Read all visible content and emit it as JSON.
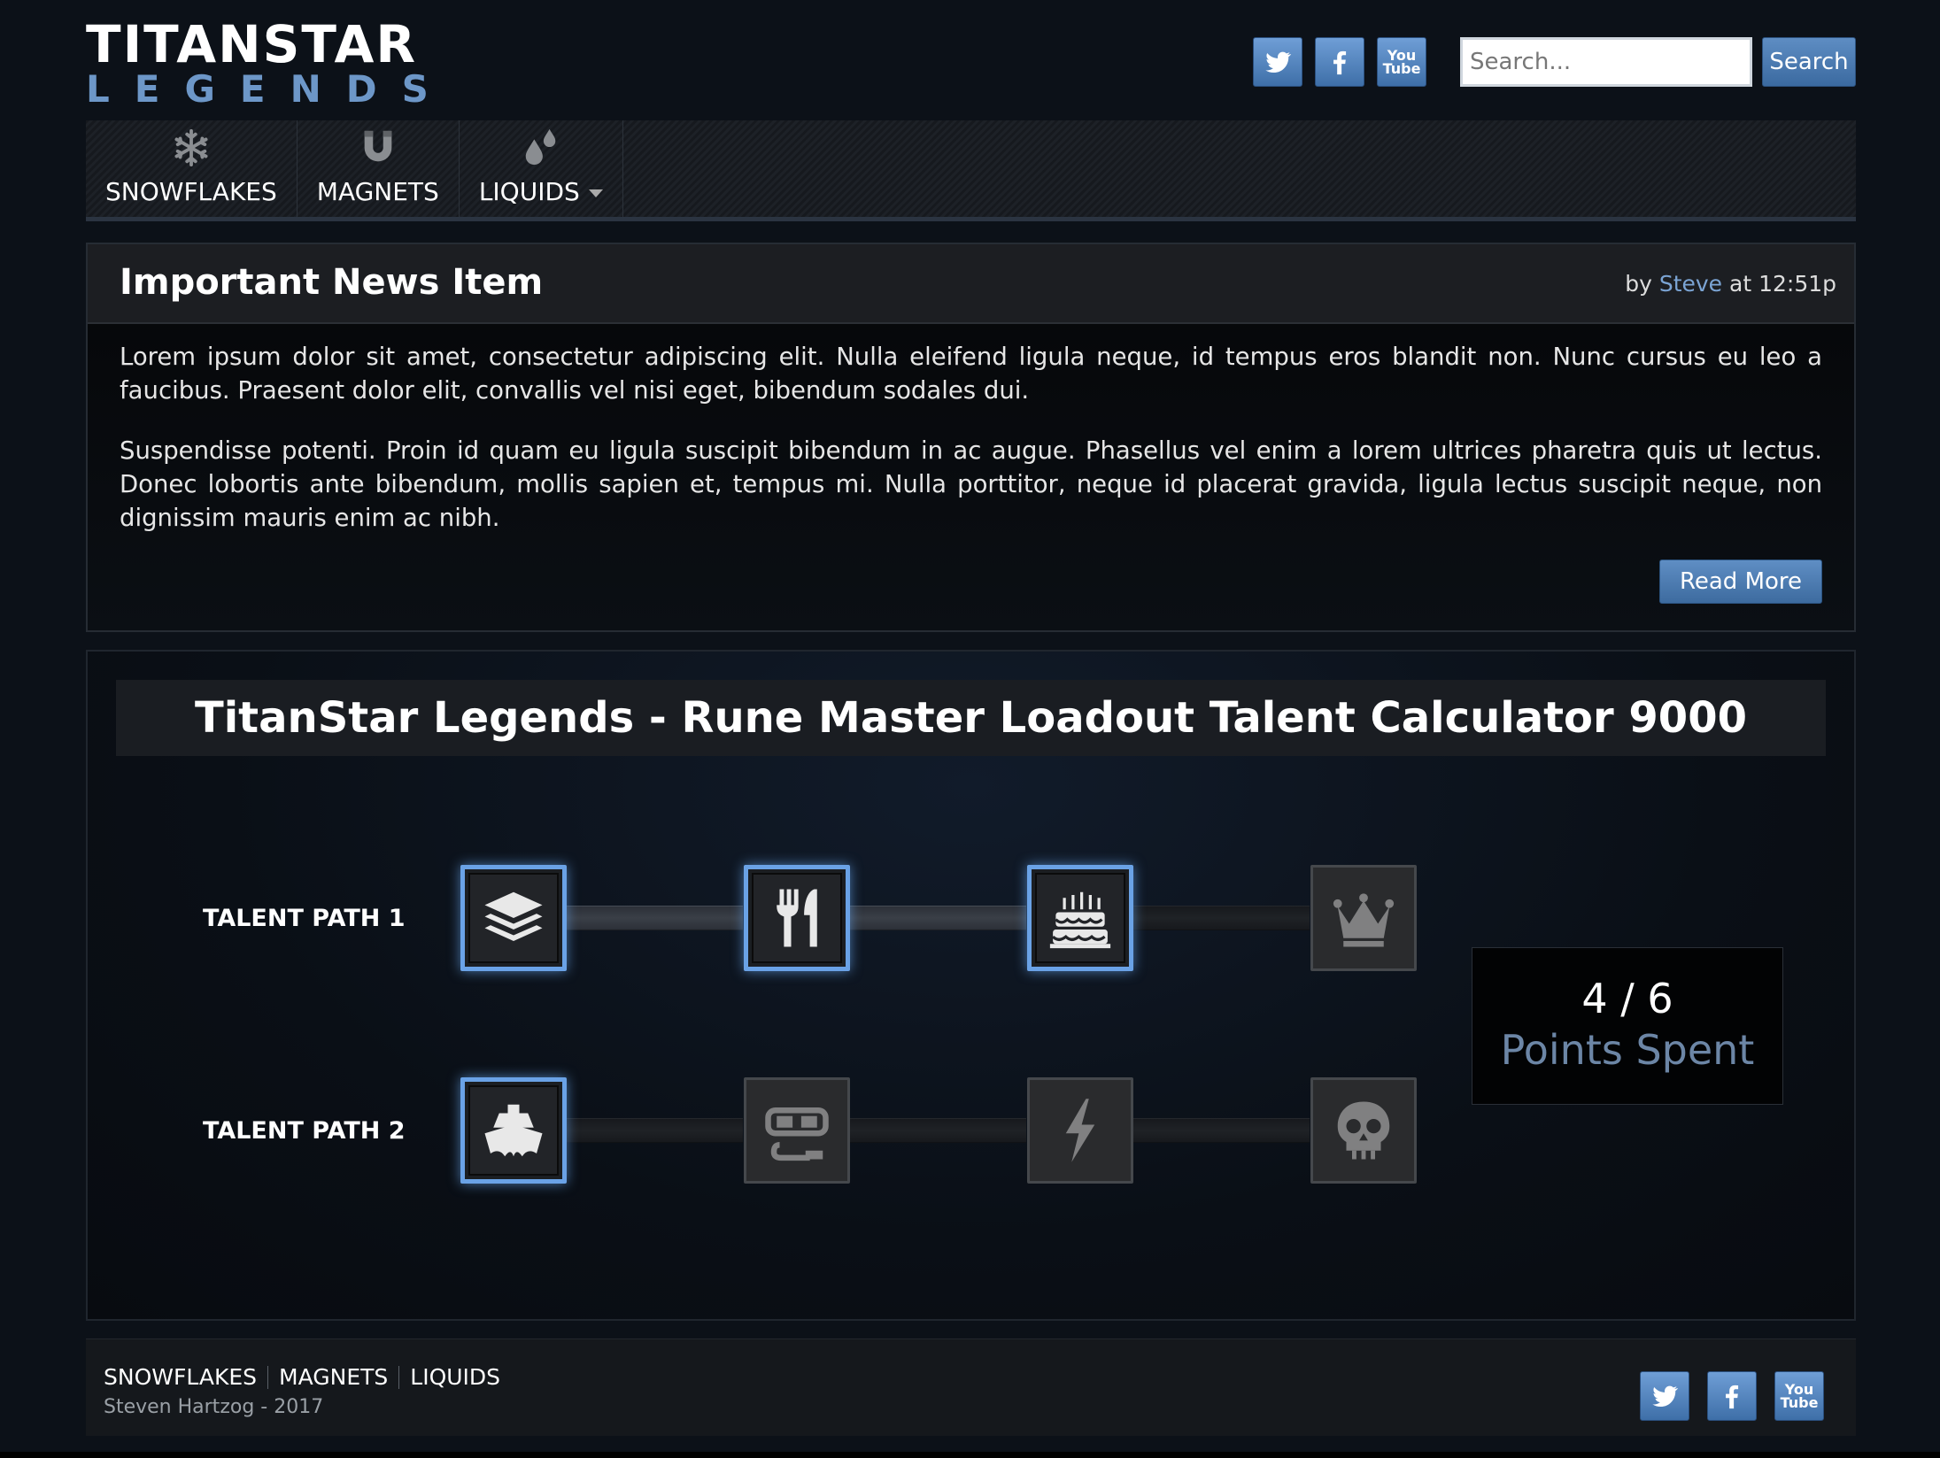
{
  "header": {
    "logo_top": "TITANSTAR",
    "logo_bottom": "LEGENDS",
    "social": [
      "twitter-icon",
      "facebook-icon",
      "youtube-icon"
    ],
    "youtube_text_1": "You",
    "youtube_text_2": "Tube",
    "search": {
      "placeholder": "Search...",
      "button_label": "Search"
    }
  },
  "nav": {
    "items": [
      {
        "label": "SNOWFLAKES",
        "icon": "snowflake-icon"
      },
      {
        "label": "MAGNETS",
        "icon": "magnet-icon"
      },
      {
        "label": "LIQUIDS",
        "icon": "droplets-icon",
        "has_dropdown": true
      }
    ]
  },
  "news": {
    "title": "Important News Item",
    "by": "by",
    "author": "Steve",
    "at": "at 12:51p",
    "paragraphs": [
      "Lorem ipsum dolor sit amet, consectetur adipiscing elit. Nulla eleifend ligula neque, id tempus eros blandit non. Nunc cursus eu leo a faucibus. Praesent dolor elit, convallis vel nisi eget, bibendum sodales dui.",
      "Suspendisse potenti. Proin id quam eu ligula suscipit bibendum in ac augue. Phasellus vel enim a lorem ultrices pharetra quis ut lectus. Donec lobortis ante bibendum, mollis sapien et, tempus mi. Nulla porttitor, neque id placerat gravida, ligula lectus suscipit neque, non dignissim mauris enim ac nibh."
    ],
    "read_more": "Read More"
  },
  "calculator": {
    "title": "TitanStar Legends - Rune Master Loadout Talent Calculator 9000",
    "paths": [
      {
        "label": "TALENT PATH 1",
        "runes": [
          {
            "icon": "stack-icon",
            "active": true
          },
          {
            "icon": "fork-knife-icon",
            "active": true
          },
          {
            "icon": "cake-icon",
            "active": true
          },
          {
            "icon": "crown-icon",
            "active": false
          }
        ]
      },
      {
        "label": "TALENT PATH 2",
        "runes": [
          {
            "icon": "ship-icon",
            "active": true
          },
          {
            "icon": "scuba-mask-icon",
            "active": false
          },
          {
            "icon": "lightning-icon",
            "active": false
          },
          {
            "icon": "skull-icon",
            "active": false
          }
        ]
      }
    ],
    "points_spent": "4 / 6",
    "points_label": "Points Spent",
    "colors": {
      "active_border": "#6aa2e6",
      "points_label": "#6c86a6"
    }
  },
  "footer": {
    "links": [
      "SNOWFLAKES",
      "MAGNETS",
      "LIQUIDS"
    ],
    "copyright": "Steven Hartzog - 2017"
  }
}
